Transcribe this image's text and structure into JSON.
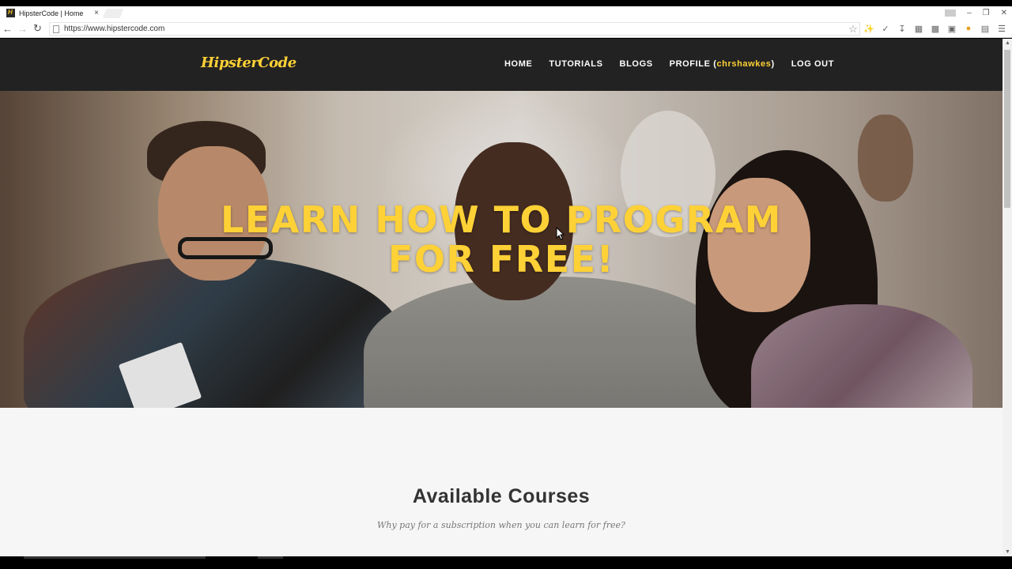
{
  "browser": {
    "tab_title": "HipsterCode | Home",
    "tab_close": "×",
    "url": "https://www.hipstercode.com",
    "window_controls": [
      "–",
      "❐",
      "✕"
    ]
  },
  "site": {
    "logo": "HipsterCode",
    "nav": {
      "home": "HOME",
      "tutorials": "TUTORIALS",
      "blogs": "BLOGS",
      "profile_prefix": "PROFILE (",
      "profile_user": "chrshawkes",
      "profile_suffix": ")",
      "logout": "LOG OUT"
    },
    "hero": {
      "line1": "LEARN HOW TO PROGRAM",
      "line2": "FOR FREE!"
    },
    "courses": {
      "title": "Available Courses",
      "subtitle": "Why pay for a subscription when you can learn for free?"
    }
  },
  "colors": {
    "accent": "#fed136",
    "nav_bg": "#222222"
  }
}
